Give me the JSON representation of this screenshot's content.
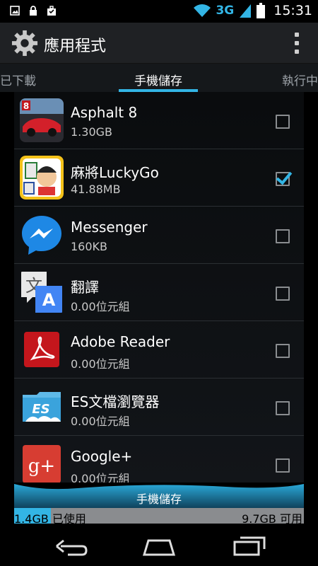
{
  "status_bar": {
    "network": "3G",
    "time": "15:31",
    "icons": [
      "image-icon",
      "lock-icon",
      "briefcase-icon",
      "wifi-icon",
      "signal-icon",
      "battery-icon"
    ]
  },
  "action_bar": {
    "title": "應用程式",
    "icon": "gear-icon",
    "menu_icon": "overflow-menu-icon"
  },
  "tabs": [
    {
      "label": "已下載"
    },
    {
      "label": "手機儲存"
    },
    {
      "label": "執行中"
    }
  ],
  "apps": [
    {
      "name": "Asphalt 8",
      "size": "1.30GB",
      "checked": false,
      "icon": "asphalt-icon"
    },
    {
      "name": "麻將LuckyGo",
      "size": "41.88MB",
      "checked": true,
      "icon": "mahjong-icon"
    },
    {
      "name": "Messenger",
      "size": "160KB",
      "checked": false,
      "icon": "messenger-icon"
    },
    {
      "name": "翻譯",
      "size": "0.00位元組",
      "checked": false,
      "icon": "translate-icon"
    },
    {
      "name": "Adobe Reader",
      "size": "0.00位元組",
      "checked": false,
      "icon": "adobe-reader-icon"
    },
    {
      "name": "ES文檔瀏覽器",
      "size": "0.00位元組",
      "checked": false,
      "icon": "es-file-explorer-icon"
    },
    {
      "name": "Google+",
      "size": "0.00位元組",
      "checked": false,
      "icon": "google-plus-icon"
    }
  ],
  "storage": {
    "title": "手機儲存",
    "used": "1.4GB 已使用",
    "free": "9.7GB 可用",
    "used_fraction": 0.126
  },
  "colors": {
    "accent": "#33b5e5",
    "background": "#0a0c0e"
  }
}
